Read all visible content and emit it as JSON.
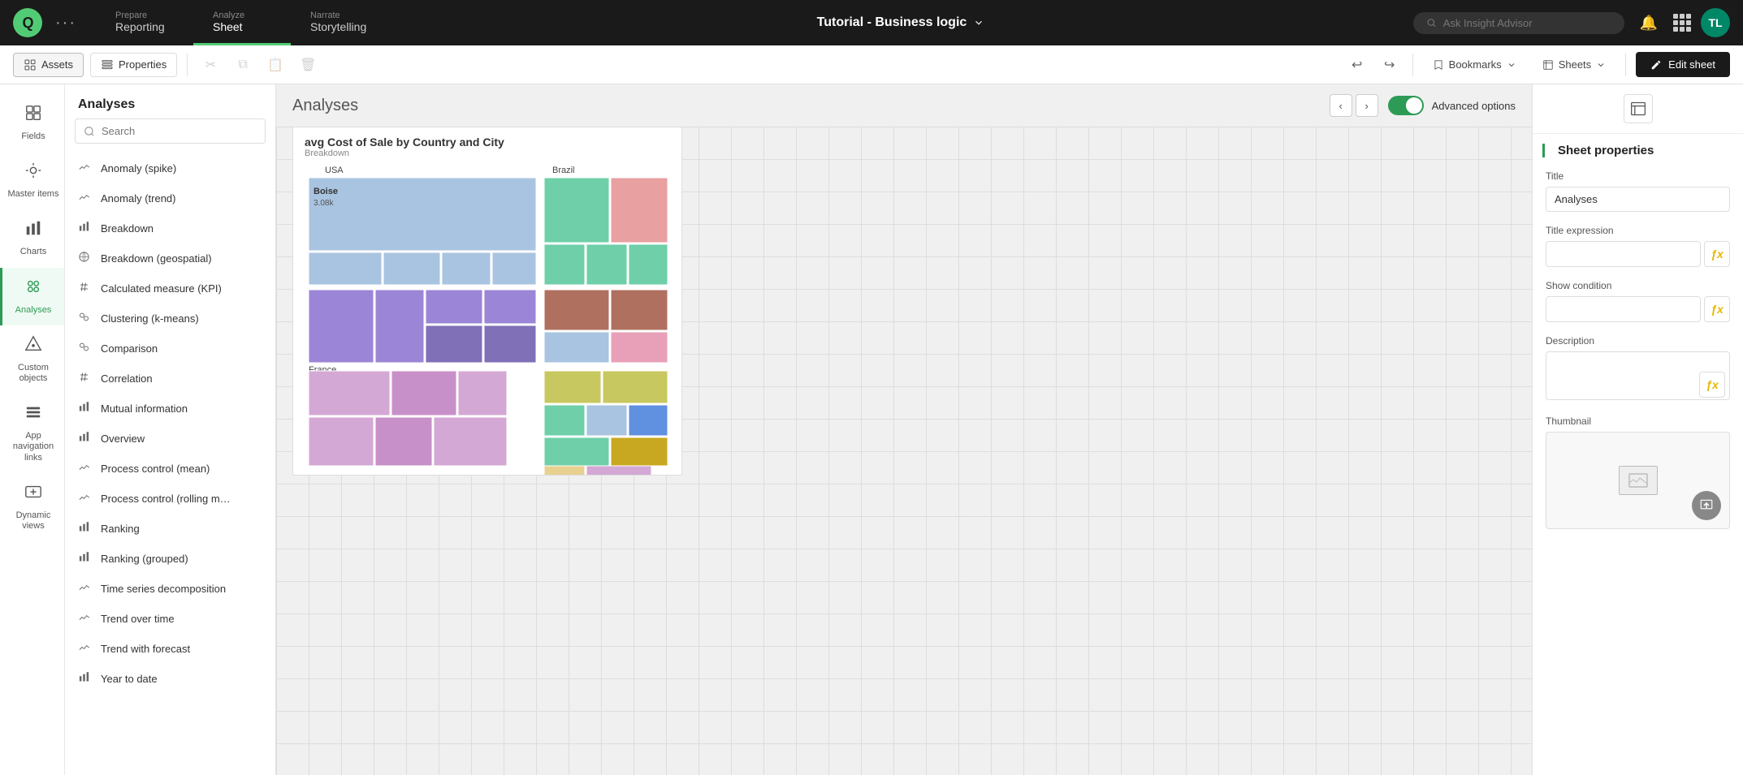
{
  "topNav": {
    "logo": "Q",
    "tabs": [
      {
        "top": "Prepare",
        "bottom": "Reporting",
        "active": false
      },
      {
        "top": "Analyze",
        "bottom": "Sheet",
        "active": true
      },
      {
        "top": "Narrate",
        "bottom": "Storytelling",
        "active": false
      }
    ],
    "appTitle": "Tutorial - Business logic",
    "searchPlaceholder": "Ask Insight Advisor",
    "avatarInitials": "TL"
  },
  "toolbar": {
    "assets": "Assets",
    "properties": "Properties",
    "bookmarks": "Bookmarks",
    "sheets": "Sheets",
    "editSheet": "Edit sheet"
  },
  "sidebar": {
    "items": [
      {
        "label": "Fields",
        "icon": "⊞",
        "active": false
      },
      {
        "label": "Master items",
        "icon": "⬡",
        "active": false
      },
      {
        "label": "Charts",
        "icon": "📊",
        "active": false
      },
      {
        "label": "Analyses",
        "icon": "⚙",
        "active": true
      },
      {
        "label": "Custom objects",
        "icon": "✦",
        "active": false
      },
      {
        "label": "App navigation links",
        "icon": "⬒",
        "active": false
      },
      {
        "label": "Dynamic views",
        "icon": "⬡",
        "active": false
      }
    ]
  },
  "analysesPanel": {
    "title": "Analyses",
    "searchPlaceholder": "Search",
    "items": [
      {
        "label": "Anomaly (spike)",
        "icon": "📈"
      },
      {
        "label": "Anomaly (trend)",
        "icon": "📈"
      },
      {
        "label": "Breakdown",
        "icon": "📊"
      },
      {
        "label": "Breakdown (geospatial)",
        "icon": "🌐"
      },
      {
        "label": "Calculated measure (KPI)",
        "icon": "#"
      },
      {
        "label": "Clustering (k-means)",
        "icon": "⊙"
      },
      {
        "label": "Comparison",
        "icon": "⊙"
      },
      {
        "label": "Correlation",
        "icon": "#"
      },
      {
        "label": "Mutual information",
        "icon": "📊"
      },
      {
        "label": "Overview",
        "icon": "📊"
      },
      {
        "label": "Process control (mean)",
        "icon": "📈"
      },
      {
        "label": "Process control (rolling m…",
        "icon": "📈"
      },
      {
        "label": "Ranking",
        "icon": "📊"
      },
      {
        "label": "Ranking (grouped)",
        "icon": "📊"
      },
      {
        "label": "Time series decomposition",
        "icon": "📈"
      },
      {
        "label": "Trend over time",
        "icon": "📈"
      },
      {
        "label": "Trend with forecast",
        "icon": "📈"
      },
      {
        "label": "Year to date",
        "icon": "📊"
      }
    ]
  },
  "canvas": {
    "title": "Analyses",
    "advancedOptions": "Advanced options",
    "chart": {
      "title": "avg Cost of Sale by Country and City",
      "subtitle": "Breakdown"
    }
  },
  "properties": {
    "sectionTitle": "Sheet properties",
    "titleLabel": "Title",
    "titleValue": "Analyses",
    "titleExpressionLabel": "Title expression",
    "showConditionLabel": "Show condition",
    "descriptionLabel": "Description",
    "thumbnailLabel": "Thumbnail"
  }
}
